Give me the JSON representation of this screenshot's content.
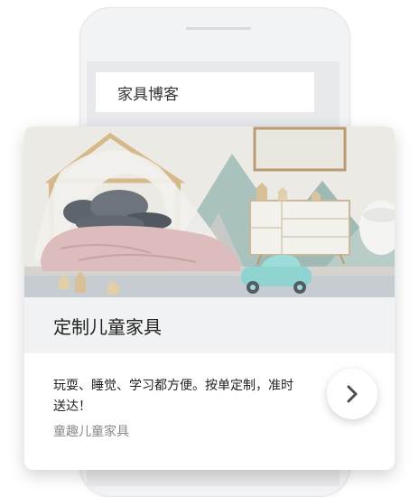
{
  "browser": {
    "address_text": "家具博客"
  },
  "card": {
    "image": "kids-bedroom-photo",
    "title": "定制儿童家具",
    "description": "玩耍、睡觉、学习都方便。按单定制，准时送达！",
    "subtitle": "童趣儿童家具",
    "next_icon": "chevron-right-icon"
  }
}
